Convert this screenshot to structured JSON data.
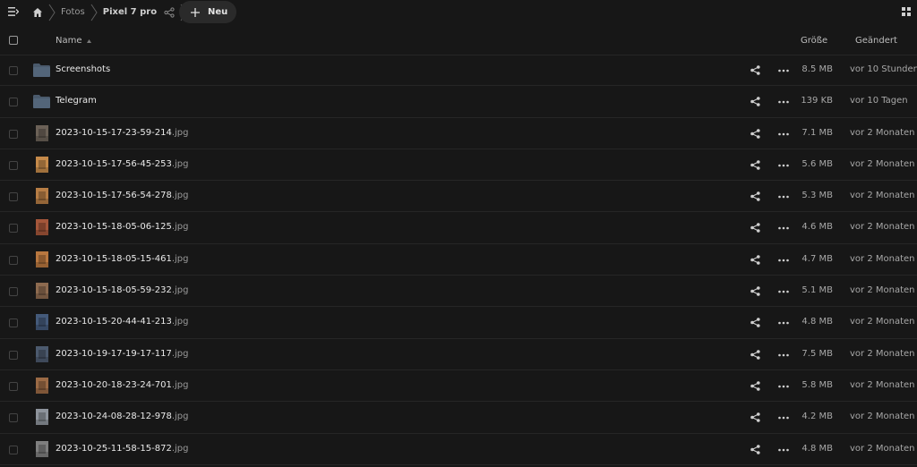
{
  "breadcrumb": {
    "items": [
      "Fotos",
      "Pixel 7 pro"
    ]
  },
  "toolbar": {
    "new_label": "Neu"
  },
  "columns": {
    "name": "Name",
    "size": "Größe",
    "modified": "Geändert"
  },
  "colors": {
    "background": "#171717",
    "folder": "#4a5a6c",
    "text": "#e4e4e4",
    "muted": "#a8a8a8"
  },
  "files": [
    {
      "type": "folder",
      "name": "Screenshots",
      "ext": "",
      "size": "8.5 MB",
      "modified": "vor 10 Stunden"
    },
    {
      "type": "folder",
      "name": "Telegram",
      "ext": "",
      "size": "139 KB",
      "modified": "vor 10 Tagen"
    },
    {
      "type": "image",
      "name": "2023-10-15-17-23-59-214",
      "ext": ".jpg",
      "size": "7.1 MB",
      "modified": "vor 2 Monaten",
      "thumb_color": "#6b6157"
    },
    {
      "type": "image",
      "name": "2023-10-15-17-56-45-253",
      "ext": ".jpg",
      "size": "5.6 MB",
      "modified": "vor 2 Monaten",
      "thumb_color": "#c58a4a"
    },
    {
      "type": "image",
      "name": "2023-10-15-17-56-54-278",
      "ext": ".jpg",
      "size": "5.3 MB",
      "modified": "vor 2 Monaten",
      "thumb_color": "#b67d45"
    },
    {
      "type": "image",
      "name": "2023-10-15-18-05-06-125",
      "ext": ".jpg",
      "size": "4.6 MB",
      "modified": "vor 2 Monaten",
      "thumb_color": "#a4563a"
    },
    {
      "type": "image",
      "name": "2023-10-15-18-05-15-461",
      "ext": ".jpg",
      "size": "4.7 MB",
      "modified": "vor 2 Monaten",
      "thumb_color": "#b8773f"
    },
    {
      "type": "image",
      "name": "2023-10-15-18-05-59-232",
      "ext": ".jpg",
      "size": "5.1 MB",
      "modified": "vor 2 Monaten",
      "thumb_color": "#8d6a4f"
    },
    {
      "type": "image",
      "name": "2023-10-15-20-44-41-213",
      "ext": ".jpg",
      "size": "4.8 MB",
      "modified": "vor 2 Monaten",
      "thumb_color": "#445a7a"
    },
    {
      "type": "image",
      "name": "2023-10-19-17-19-17-117",
      "ext": ".jpg",
      "size": "7.5 MB",
      "modified": "vor 2 Monaten",
      "thumb_color": "#4c5a6e"
    },
    {
      "type": "image",
      "name": "2023-10-20-18-23-24-701",
      "ext": ".jpg",
      "size": "5.8 MB",
      "modified": "vor 2 Monaten",
      "thumb_color": "#9b6a45"
    },
    {
      "type": "image",
      "name": "2023-10-24-08-28-12-978",
      "ext": ".jpg",
      "size": "4.2 MB",
      "modified": "vor 2 Monaten",
      "thumb_color": "#8e949c"
    },
    {
      "type": "image",
      "name": "2023-10-25-11-58-15-872",
      "ext": ".jpg",
      "size": "4.8 MB",
      "modified": "vor 2 Monaten",
      "thumb_color": "#7f7f7f"
    }
  ]
}
